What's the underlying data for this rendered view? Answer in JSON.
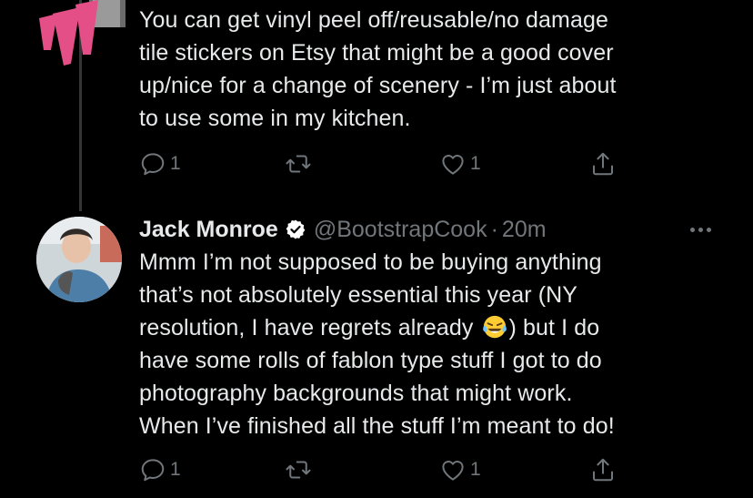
{
  "colors": {
    "background": "#000000",
    "text": "#e7e9ea",
    "muted": "#71767b",
    "verified_badge": "#ffffff",
    "thread_line": "#333639"
  },
  "tweet_top": {
    "text": "You can get vinyl peel off/reusable/no damage\ntile stickers on Etsy that might be a good cover\nup/nice for a change of scenery - I’m just about\nto use some in my kitchen.",
    "actions": {
      "reply_count": "1",
      "retweet_count": "",
      "like_count": "1"
    },
    "icons": {
      "reply": "reply-icon",
      "retweet": "retweet-icon",
      "like": "heart-icon",
      "share": "share-icon"
    }
  },
  "tweet_main": {
    "author": {
      "name": "Jack Monroe",
      "handle": "@BootstrapCook",
      "separator": "·",
      "time": "20m",
      "verified": true
    },
    "text_before_emoji": "Mmm I’m not supposed to be buying anything\nthat’s not absolutely essential this year (NY\nresolution, I have regrets already ",
    "emoji": "tears-of-joy-emoji",
    "text_after_emoji": ") but I do\nhave some rolls of fablon type stuff I got to do\nphotography backgrounds that might work.\nWhen I’ve finished all the stuff I’m meant to do!",
    "actions": {
      "reply_count": "1",
      "retweet_count": "",
      "like_count": "1"
    }
  }
}
